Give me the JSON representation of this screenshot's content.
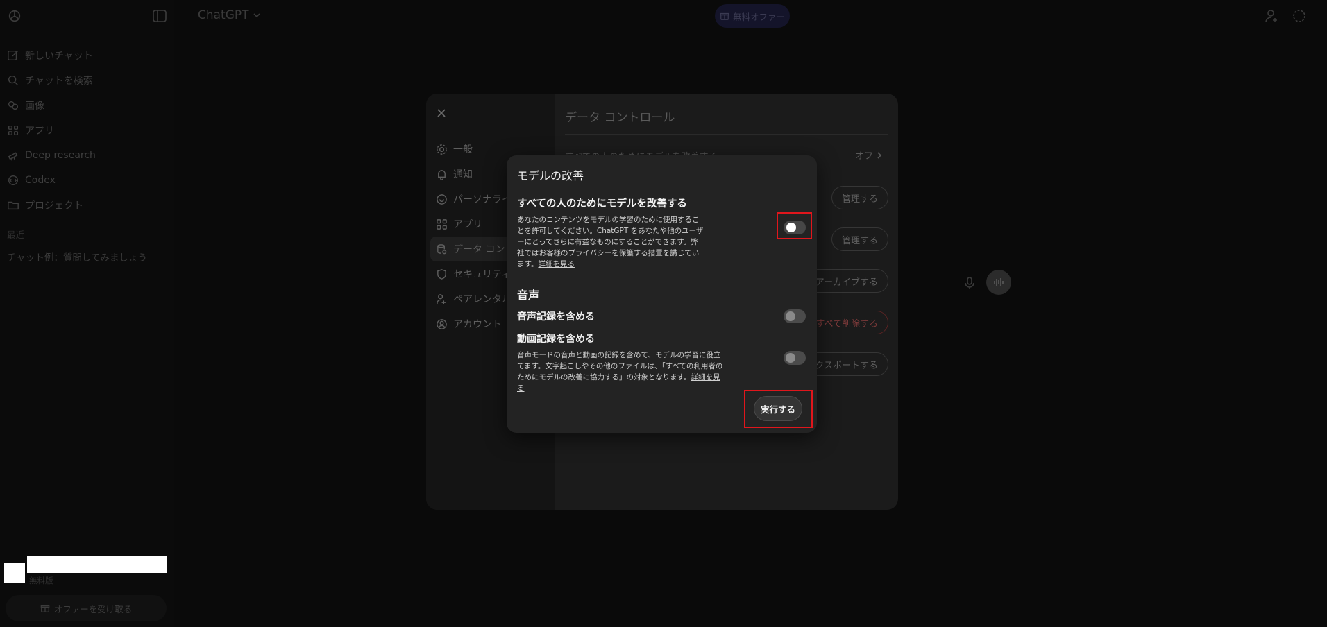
{
  "sidebar": {
    "items": [
      {
        "label": "新しいチャット",
        "icon": "compose-icon"
      },
      {
        "label": "チャットを検索",
        "icon": "search-icon"
      },
      {
        "label": "画像",
        "icon": "image-icon"
      },
      {
        "label": "アプリ",
        "icon": "apps-icon"
      },
      {
        "label": "Deep research",
        "icon": "telescope-icon"
      },
      {
        "label": "Codex",
        "icon": "codex-icon"
      },
      {
        "label": "プロジェクト",
        "icon": "folder-icon"
      }
    ],
    "section_label": "最近",
    "recent_chat": "チャット例：質問してみましょう",
    "plan": "無料版",
    "offer_button": "オファーを受け取る"
  },
  "topbar": {
    "brand": "ChatGPT",
    "free_offer": "無料オファー"
  },
  "settings": {
    "nav": [
      {
        "label": "一般",
        "icon": "gear-icon"
      },
      {
        "label": "通知",
        "icon": "bell-icon"
      },
      {
        "label": "パーソナライズ",
        "icon": "personalize-icon"
      },
      {
        "label": "アプリ",
        "icon": "apps-icon"
      },
      {
        "label": "データ コントロール",
        "icon": "database-icon"
      },
      {
        "label": "セキュリティ",
        "icon": "shield-icon"
      },
      {
        "label": "ペアレンタル コントロール",
        "icon": "parental-icon"
      },
      {
        "label": "アカウント",
        "icon": "account-icon"
      }
    ],
    "panel_title": "データ コントロール",
    "row1_label": "すべての人のためにモデルを改善する",
    "row1_value": "オフ",
    "manage_1": "管理する",
    "manage_2": "管理する",
    "archive_all": "すべてアーカイブする",
    "delete_all": "すべて削除する",
    "export": "エクスポートする"
  },
  "modal": {
    "title": "モデルの改善",
    "improve_heading": "すべての人のためにモデルを改善する",
    "improve_desc": "あなたのコンテンツをモデルの学習のために使用することを許可してください。ChatGPT をあなたや他のユーザーにとってさらに有益なものにすることができます。弊社ではお客様のプライバシーを保護する措置を講じています。",
    "learn_more": "詳細を見る",
    "voice_section": "音声",
    "include_audio": "音声記録を含める",
    "include_video": "動画記録を含める",
    "voice_desc": "音声モードの音声と動画の記録を含めて、モデルの学習に役立てます。文字起こしやその他のファイルは、「すべての利用者のためにモデルの改善に協力する」の対象となります。",
    "learn_more_2": "詳細を見る",
    "execute_button": "実行する",
    "improve_toggle_on": false,
    "audio_toggle_on": false,
    "video_toggle_on": false
  },
  "colors": {
    "highlight": "#e0161c",
    "modal_bg": "#232323",
    "page_bg": "#0a0a0a"
  }
}
